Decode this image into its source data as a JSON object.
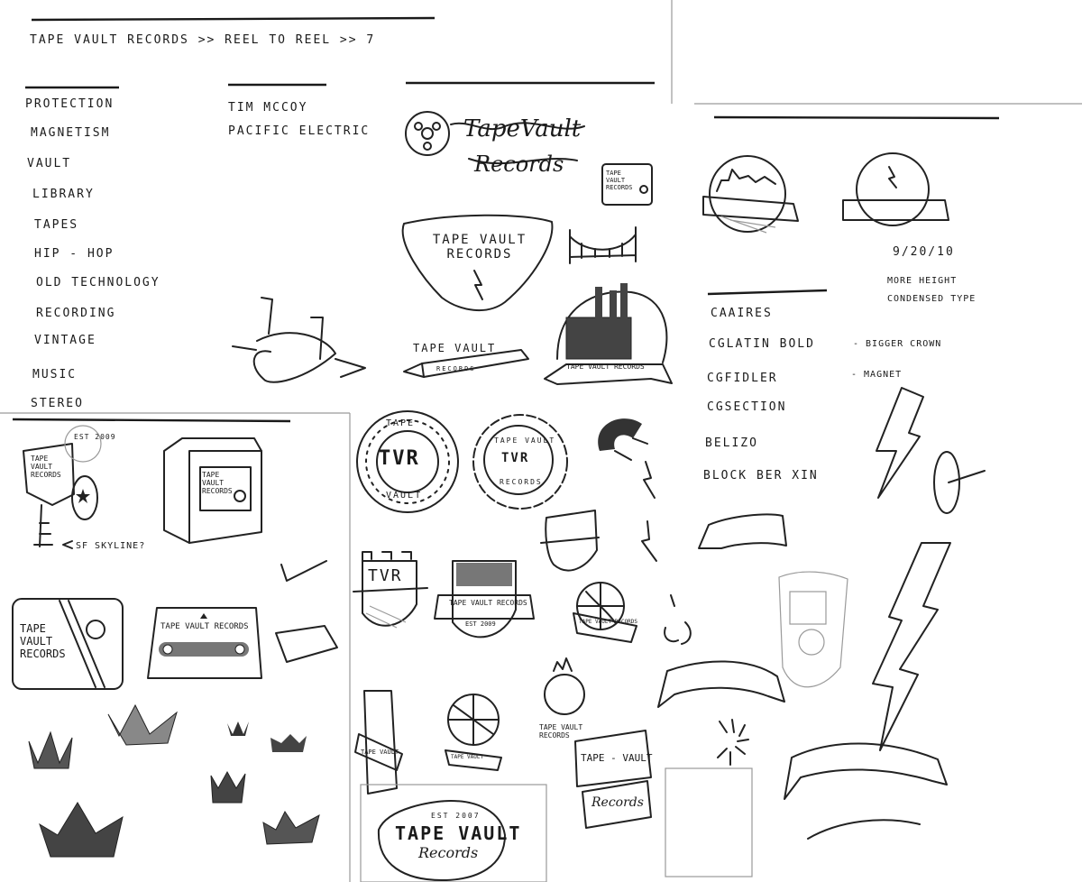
{
  "breadcrumb": {
    "label": "TAPE VAULT RECORDS >> REEL TO REEL >> 7"
  },
  "keywords": [
    "PROTECTION",
    "MAGNETISM",
    "VAULT",
    "LIBRARY",
    "TAPES",
    "HIP - HOP",
    "OLD TECHNOLOGY",
    "RECORDING",
    "VINTAGE",
    "MUSIC",
    "STEREO"
  ],
  "references": [
    "TIM MCCOY",
    "PACIFIC ELECTRIC"
  ],
  "fonts": [
    "CAAIRES",
    "CGLATIN BOLD",
    "CGFIDLER",
    "CGSECTION",
    "BELIZO",
    "BLOCK BER XIN"
  ],
  "notes": {
    "date": "9/20/10",
    "more_height": "MORE HEIGHT",
    "condensed": "CONDENSED TYPE",
    "bigger_crown": "- BIGGER CROWN",
    "magnet": "- MAGNET",
    "sf_skyline": "SF SKYLINE?",
    "est": "EST 2009"
  },
  "logos": {
    "script_top": "TapeVault",
    "script_bottom": "Records",
    "small_box": "TAPE VAULT RECORDS",
    "shield_main": "TAPE VAULT RECORDS",
    "arrow_top": "TAPE VAULT",
    "arrow_bottom": "RECORDS",
    "factory_banner": "TAPE VAULT RECORDS",
    "seal_left_top": "TAPE",
    "seal_left_mid": "TVR",
    "seal_left_bottom": "VAULT",
    "seal_right_top": "TAPE VAULT",
    "seal_right_mid": "TVR",
    "seal_right_bottom": "RECORDS",
    "key_tag": "TAPE VAULT RECORDS",
    "box_label": "TAPE VAULT RECORDS",
    "tape_box": "TAPE VAULT RECORDS",
    "cassette": "TAPE VAULT RECORDS",
    "crest_tvr": "TVR",
    "shield_banner": "TAPE VAULT RECORDS",
    "shield_est": "EST 2009",
    "globe_banner": "TAPE VAULT RECORDS",
    "globe_crown_caption": "TAPE VAULT RECORDS",
    "vertical_banner": "TAPE VAULT",
    "globe_small_banner": "TAPE VAULT",
    "tape_vault_tag": "TAPE - VAULT",
    "records_tag": "Records",
    "bottom_est": "EST 2007",
    "bottom_title": "TAPE VAULT",
    "bottom_sub": "Records"
  }
}
